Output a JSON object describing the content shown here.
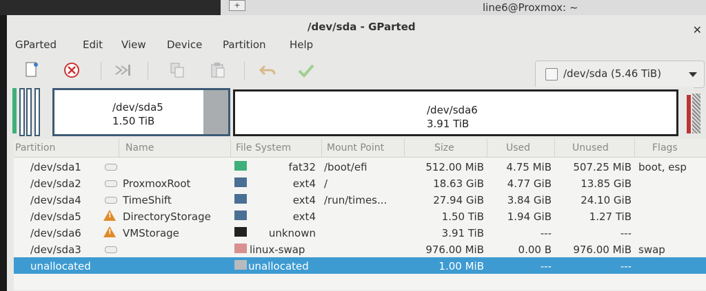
{
  "bg_window_title": "line6@Proxmox: ~",
  "window": {
    "title": "/dev/sda - GParted"
  },
  "menu": [
    "GParted",
    "Edit",
    "View",
    "Device",
    "Partition",
    "Help"
  ],
  "toolbar": {
    "icons": [
      "new-icon",
      "delete-icon",
      "resize-move-icon",
      "copy-icon",
      "paste-icon",
      "undo-icon",
      "apply-icon"
    ],
    "device_label": "/dev/sda (5.46 TiB)"
  },
  "map": {
    "sda5_name": "/dev/sda5",
    "sda5_size": "1.50 TiB",
    "sda6_name": "/dev/sda6",
    "sda6_size": "3.91 TiB"
  },
  "table": {
    "headers": [
      "Partition",
      "Name",
      "File System",
      "Mount Point",
      "Size",
      "Used",
      "Unused",
      "Flags"
    ],
    "rows": [
      {
        "partition": "/dev/sda1",
        "name": "",
        "fs": "fat32",
        "fs_color": "#3fb07a",
        "mount": "/boot/efi",
        "size": "512.00 MiB",
        "used": "4.75 MiB",
        "unused": "507.25 MiB",
        "flags": "boot, esp"
      },
      {
        "partition": "/dev/sda2",
        "name": "ProxmoxRoot",
        "fs": "ext4",
        "fs_color": "#4a6f94",
        "mount": "/",
        "size": "18.63 GiB",
        "used": "4.77 GiB",
        "unused": "13.85 GiB",
        "flags": ""
      },
      {
        "partition": "/dev/sda4",
        "name": "TimeShift",
        "fs": "ext4",
        "fs_color": "#4a6f94",
        "mount": "/run/times...",
        "size": "27.94 GiB",
        "used": "3.84 GiB",
        "unused": "24.10 GiB",
        "flags": ""
      },
      {
        "partition": "/dev/sda5",
        "name": "DirectoryStorage",
        "fs": "ext4",
        "fs_color": "#4a6f94",
        "mount": "",
        "size": "1.50 TiB",
        "used": "1.94 GiB",
        "unused": "1.27 TiB",
        "flags": ""
      },
      {
        "partition": "/dev/sda6",
        "name": "VMStorage",
        "fs": "unknown",
        "fs_color": "#222222",
        "mount": "",
        "size": "3.91 TiB",
        "used": "---",
        "unused": "---",
        "flags": ""
      },
      {
        "partition": "/dev/sda3",
        "name": "",
        "fs": "linux-swap",
        "fs_color": "#d99090",
        "mount": "",
        "size": "976.00 MiB",
        "used": "0.00 B",
        "unused": "976.00 MiB",
        "flags": "swap"
      },
      {
        "partition": "unallocated",
        "name": "",
        "fs": "unallocated",
        "fs_color": "#b8bbbd",
        "mount": "",
        "size": "1.00 MiB",
        "used": "---",
        "unused": "---",
        "flags": ""
      }
    ]
  }
}
